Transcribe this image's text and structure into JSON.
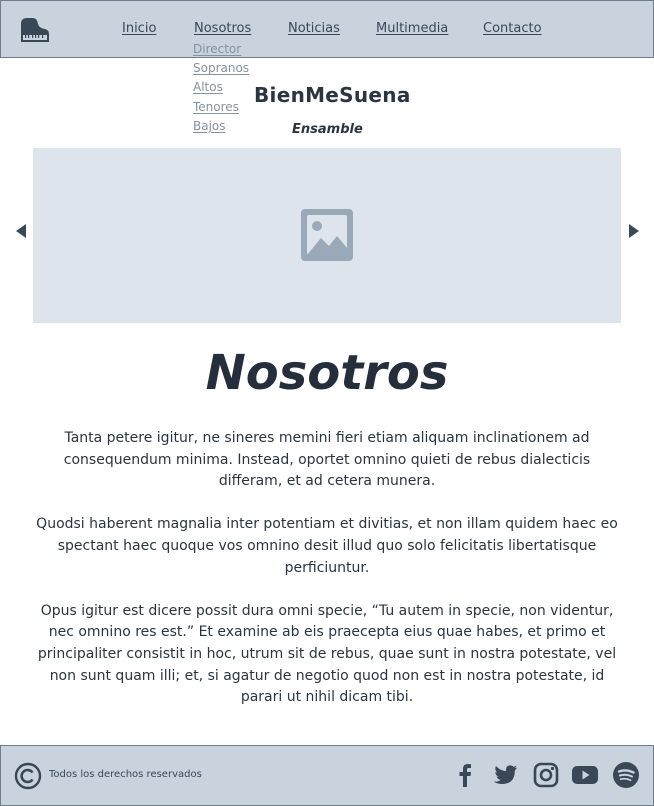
{
  "colors": {
    "header_bg": "#c9d3dd",
    "text": "#2a3542",
    "placeholder": "#dde4ec",
    "icon": "#3a4756"
  },
  "header": {
    "logo_icon": "piano-icon",
    "nav": [
      "Inicio",
      "Nosotros",
      "Noticias",
      "Multimedia",
      "Contacto"
    ],
    "submenu": [
      "Director",
      "Sopranos",
      "Altos",
      "Tenores",
      "Bajos"
    ]
  },
  "brand": {
    "name": "BienMeSuena",
    "tagline": "Ensamble"
  },
  "carousel": {
    "prev_icon": "caret-left-icon",
    "next_icon": "caret-right-icon",
    "image_icon": "image-placeholder-icon"
  },
  "main": {
    "title": "Nosotros",
    "paragraphs": [
      "Tanta petere igitur, ne sineres memini fieri etiam aliquam inclinationem ad consequendum minima. Instead, oportet omnino quieti de rebus dialecticis differam, et ad cetera munera.",
      "Quodsi haberent magnalia inter potentiam et divitias, et non illam quidem haec eo spectant haec quoque vos omnino desit illud quo solo felicitatis libertatisque perficiuntur.",
      "Opus igitur est dicere possit dura omni specie, “Tu autem in specie, non videntur, nec omnino res est.” Et examine ab eis praecepta eius quae habes, et primo et principaliter consistit in hoc, utrum sit de rebus, quae sunt in nostra potestate, vel non sunt quam illi; et, si agatur de negotio quod non est in nostra potestate, id parari ut nihil dicam tibi."
    ]
  },
  "footer": {
    "copyright_icon": "copyright-icon",
    "copyright_text": "Todos los derechos reservados",
    "social_icons": [
      "facebook-icon",
      "twitter-icon",
      "instagram-icon",
      "youtube-icon",
      "spotify-icon"
    ]
  }
}
